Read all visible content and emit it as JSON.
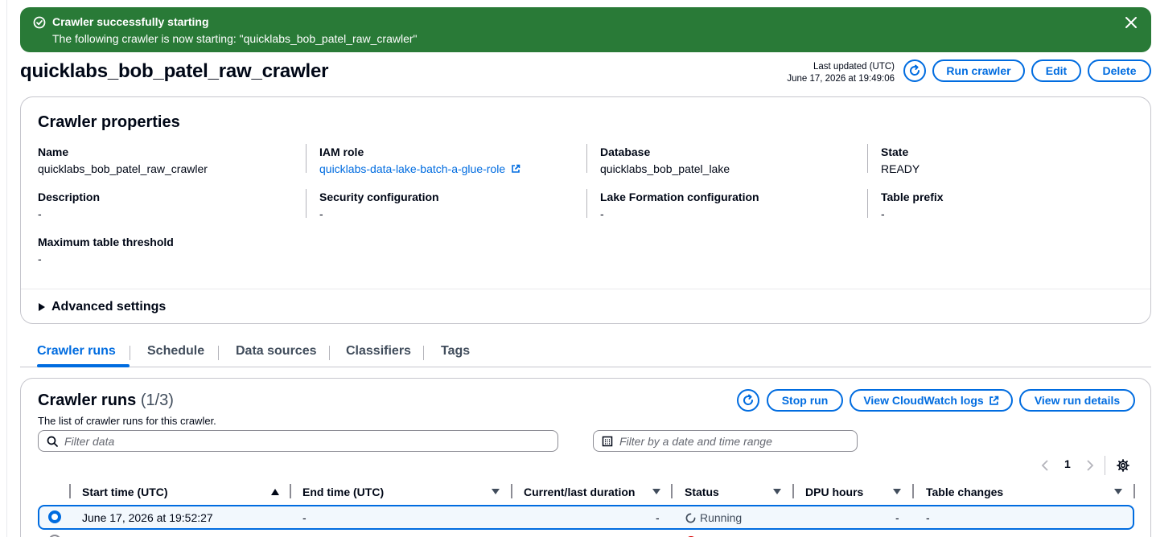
{
  "flash": {
    "title": "Crawler successfully starting",
    "message": "The following crawler is now starting: \"quicklabs_bob_patel_raw_crawler\"",
    "color": "#297a37"
  },
  "header": {
    "title": "quicklabs_bob_patel_raw_crawler",
    "last_updated_label": "Last updated (UTC)",
    "last_updated_value": "June 17, 2026 at 19:49:06",
    "run_label": "Run crawler",
    "edit_label": "Edit",
    "delete_label": "Delete"
  },
  "properties": {
    "title": "Crawler properties",
    "name_label": "Name",
    "name_value": "quicklabs_bob_patel_raw_crawler",
    "iam_label": "IAM role",
    "iam_value": "quicklabs-data-lake-batch-a-glue-role",
    "db_label": "Database",
    "db_value": "quicklabs_bob_patel_lake",
    "state_label": "State",
    "state_value": "READY",
    "desc_label": "Description",
    "desc_value": "-",
    "sec_label": "Security configuration",
    "sec_value": "-",
    "lf_label": "Lake Formation configuration",
    "lf_value": "-",
    "prefix_label": "Table prefix",
    "prefix_value": "-",
    "max_label": "Maximum table threshold",
    "max_value": "-",
    "advanced_label": "Advanced settings"
  },
  "tabs": [
    "Crawler runs",
    "Schedule",
    "Data sources",
    "Classifiers",
    "Tags"
  ],
  "runs": {
    "title": "Crawler runs",
    "count": "(1/3)",
    "description": "The list of crawler runs for this crawler.",
    "stop_label": "Stop run",
    "logs_label": "View CloudWatch logs",
    "details_label": "View run details",
    "filter_placeholder": "Filter data",
    "date_placeholder": "Filter by a date and time range",
    "page": "1",
    "columns": [
      "Start time (UTC)",
      "End time (UTC)",
      "Current/last duration",
      "Status",
      "DPU hours",
      "Table changes"
    ],
    "row": {
      "start": "June 17, 2026 at 19:52:27",
      "end": "-",
      "duration": "-",
      "status": "Running",
      "dpu": "-",
      "changes": "-"
    }
  },
  "colors": {
    "accent": "#006ce0",
    "success": "#297a37",
    "error": "#db0000"
  }
}
